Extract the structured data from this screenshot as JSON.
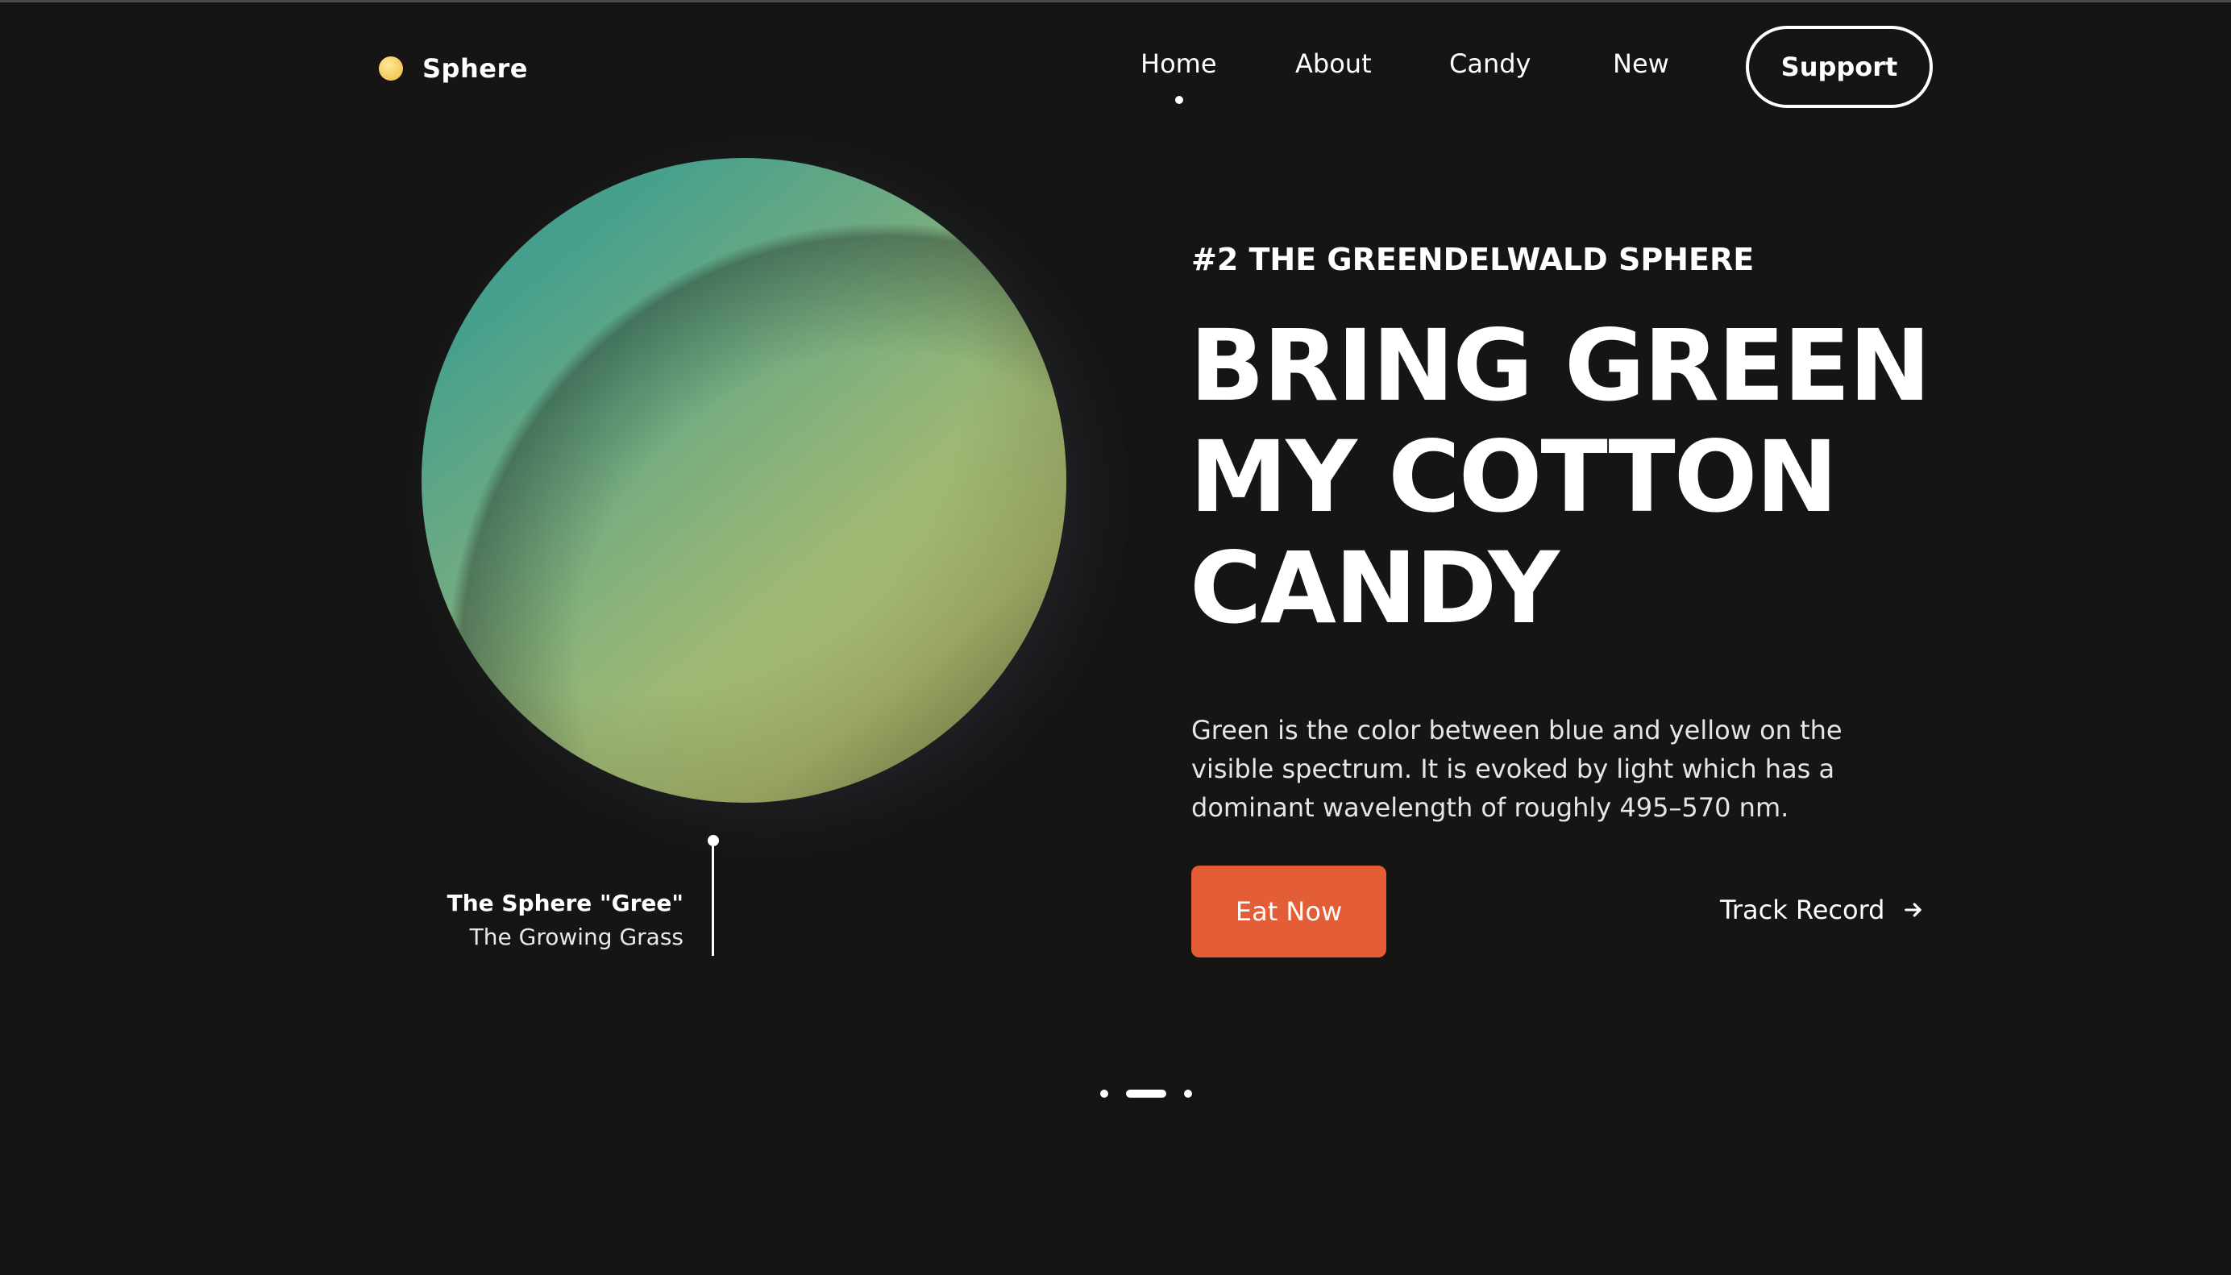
{
  "brand": {
    "name": "Sphere"
  },
  "nav": {
    "items": [
      {
        "label": "Home",
        "active": true
      },
      {
        "label": "About"
      },
      {
        "label": "Candy"
      },
      {
        "label": "New"
      }
    ],
    "support_label": "Support"
  },
  "sphere": {
    "title": "The Sphere \"Gree\"",
    "subtitle": "The Growing Grass"
  },
  "hero": {
    "eyebrow": "#2 THE GREENDELWALD SPHERE",
    "headline_lines": [
      "BRING GREEN",
      "MY COTTON",
      "CANDY"
    ],
    "description": "Green is the color between blue and yellow on the visible spectrum. It is evoked by light which has a dominant wavelength of roughly 495–570 nm.",
    "primary_cta": "Eat Now",
    "secondary_cta": "Track Record"
  },
  "pagination": {
    "total": 3,
    "active_index": 1
  },
  "colors": {
    "background": "#161514",
    "accent": "#e35d36",
    "text": "#ffffff"
  }
}
